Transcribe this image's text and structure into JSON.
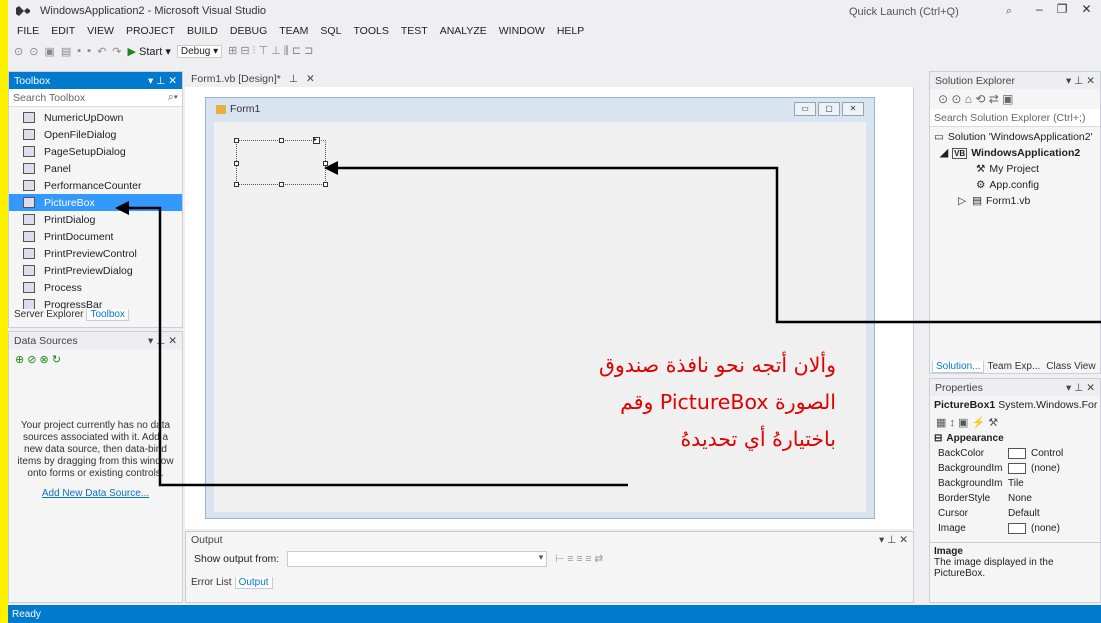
{
  "window": {
    "title": "WindowsApplication2 - Microsoft Visual Studio",
    "quick_launch": "Quick Launch (Ctrl+Q)"
  },
  "menu": [
    "FILE",
    "EDIT",
    "VIEW",
    "PROJECT",
    "BUILD",
    "DEBUG",
    "TEAM",
    "SQL",
    "TOOLS",
    "TEST",
    "ANALYZE",
    "WINDOW",
    "HELP"
  ],
  "toolbar": {
    "start_label": "Start",
    "config": "Debug"
  },
  "toolbox": {
    "title": "Toolbox",
    "search_placeholder": "Search Toolbox",
    "items": [
      "NumericUpDown",
      "OpenFileDialog",
      "PageSetupDialog",
      "Panel",
      "PerformanceCounter",
      "PictureBox",
      "PrintDialog",
      "PrintDocument",
      "PrintPreviewControl",
      "PrintPreviewDialog",
      "Process",
      "ProgressBar"
    ],
    "selected": "PictureBox",
    "tabs": [
      "Server Explorer",
      "Toolbox"
    ]
  },
  "datasources": {
    "title": "Data Sources",
    "message": "Your project currently has no data sources associated with it. Add a new data source, then data-bind items by dragging from this window onto forms or existing controls.",
    "link": "Add New Data Source..."
  },
  "designer": {
    "tab": "Form1.vb [Design]*",
    "form_title": "Form1"
  },
  "annotation": {
    "lines": [
      "وألان أتجه نحو نافذة صندوق",
      "الصورة   PictureBox  وقم",
      "باختيارهُ أي تحديدهُ"
    ]
  },
  "output": {
    "title": "Output",
    "show_from": "Show output from:",
    "tabs": [
      "Error List",
      "Output"
    ]
  },
  "solution_explorer": {
    "title": "Solution Explorer",
    "search": "Search Solution Explorer (Ctrl+;)",
    "solution": "Solution 'WindowsApplication2'",
    "project": "WindowsApplication2",
    "children": [
      "My Project",
      "App.config",
      "Form1.vb"
    ],
    "tabs": [
      "Solution...",
      "Team Exp...",
      "Class View"
    ]
  },
  "properties": {
    "title": "Properties",
    "object": "PictureBox1",
    "type": "System.Windows.For",
    "category": "Appearance",
    "rows": [
      {
        "name": "BackColor",
        "value": "Control"
      },
      {
        "name": "BackgroundIm",
        "value": "(none)"
      },
      {
        "name": "BackgroundIm",
        "value": "Tile"
      },
      {
        "name": "BorderStyle",
        "value": "None"
      },
      {
        "name": "Cursor",
        "value": "Default"
      },
      {
        "name": "Image",
        "value": "(none)"
      }
    ],
    "desc_title": "Image",
    "desc_text": "The image displayed in the PictureBox."
  },
  "status": "Ready",
  "colors": {
    "accent": "#007ACC",
    "annotation": "#E00000",
    "background": "#FFF200"
  }
}
